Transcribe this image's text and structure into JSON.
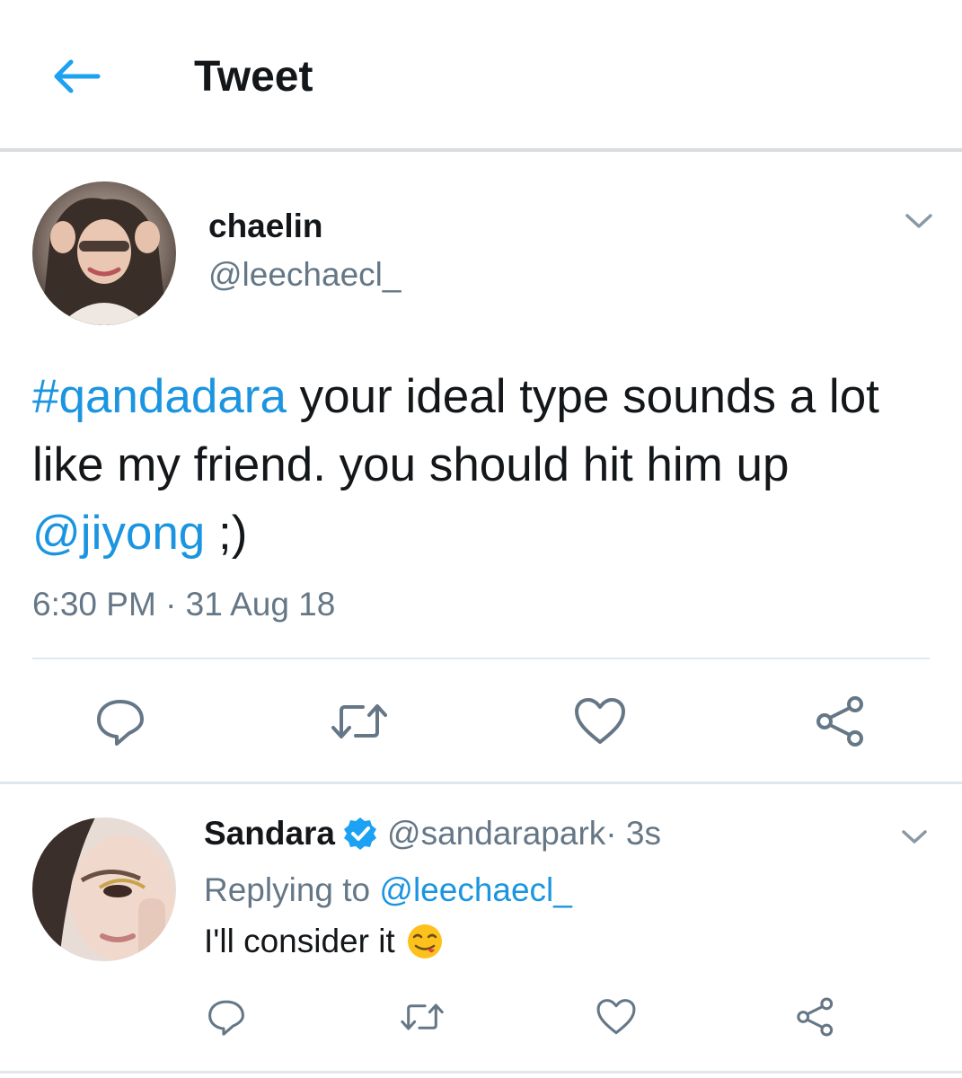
{
  "header": {
    "title": "Tweet",
    "back_icon": "arrow-left-icon",
    "accent": "#1da1f2"
  },
  "tweet": {
    "author_name": "chaelin",
    "author_handle": "@leechaecl_",
    "hashtag": "#qandadara",
    "text_part1": " your ideal type sounds a lot like my friend. you should hit him up ",
    "mention": "@jiyong",
    "text_part2": " ;)",
    "timestamp": "6:30 PM · 31 Aug 18",
    "actions": [
      "reply-icon",
      "retweet-icon",
      "like-icon",
      "share-icon"
    ]
  },
  "reply": {
    "author_name": "Sandara",
    "verified": true,
    "author_handle": "@sandarapark",
    "time": " · 3s",
    "replying_prefix": "Replying to ",
    "replying_to": "@leechaecl_",
    "text": "I'll consider it",
    "emoji": "face-savouring-food-emoji",
    "actions": [
      "reply-icon",
      "retweet-icon",
      "like-icon",
      "share-icon"
    ]
  },
  "colors": {
    "link": "#1b95e0",
    "muted": "#657786",
    "text": "#14171a",
    "divider": "#e1e8ed"
  }
}
